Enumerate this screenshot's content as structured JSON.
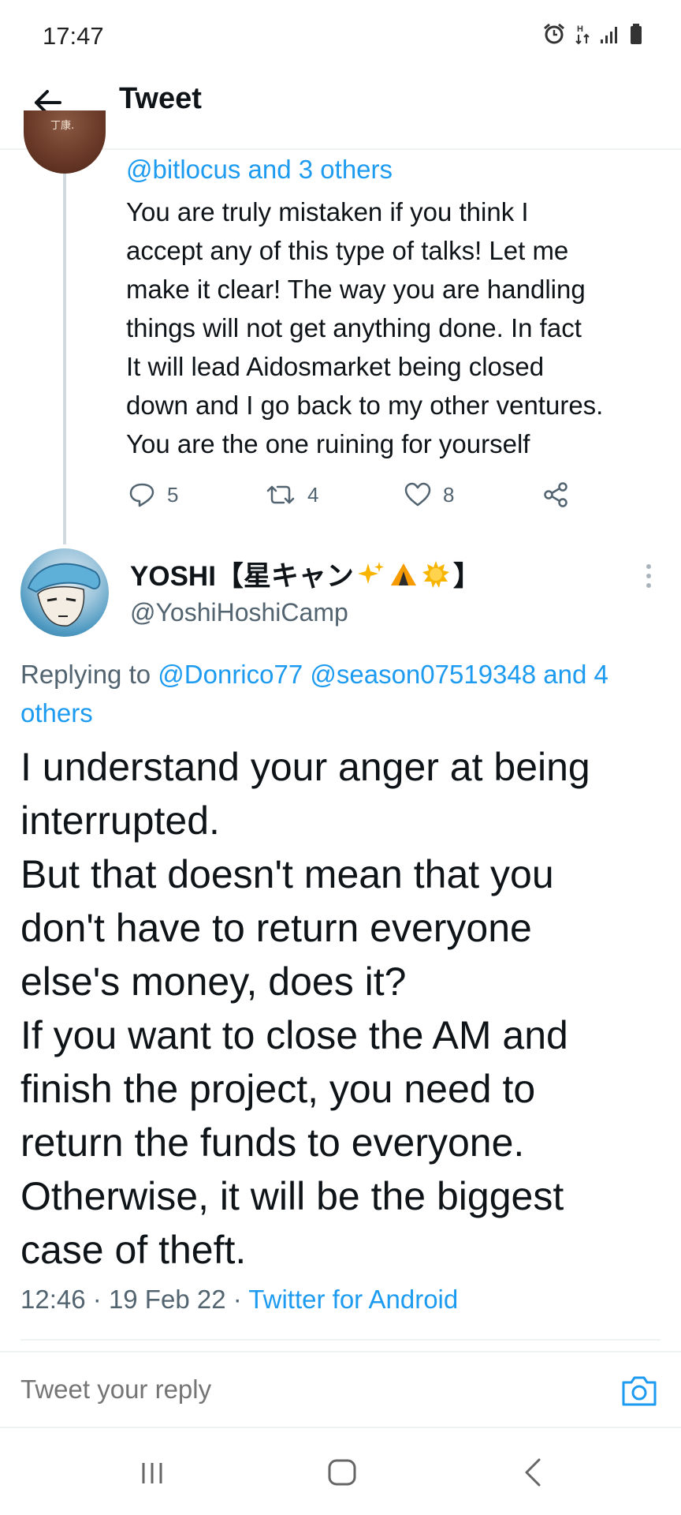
{
  "status_bar": {
    "time": "17:47"
  },
  "header": {
    "title": "Tweet"
  },
  "prev_tweet": {
    "avatar_text": "丁康.",
    "mentions": "@bitlocus and 3 others",
    "text": "You are truly mistaken if you think I\naccept any of this type of talks! Let me\nmake it clear! The way you are handling\nthings will not get anything done. In fact\nIt will lead Aidosmarket being closed\ndown and I go back to my other ventures.\nYou are the one ruining for yourself",
    "reply_count": "5",
    "retweet_count": "4",
    "like_count": "8"
  },
  "tweet": {
    "author_name": "YOSHI【星キャン",
    "author_name_end": "】",
    "handle": "@YoshiHoshiCamp",
    "replying_prefix": "Replying to",
    "replying_users": "@Donrico77 @season07519348 and 4 others",
    "text": "I understand your anger at being\ninterrupted.\nBut that doesn't mean that you\ndon't have to return everyone\nelse's money, does it?\nIf you want to close the AM and\nfinish the project, you need to\nreturn the funds to everyone.\nOtherwise, it will be the biggest\ncase of theft.",
    "time": "12:46",
    "date": "19 Feb 22",
    "source": "Twitter for Android"
  },
  "reply_box": {
    "placeholder": "Tweet your reply"
  },
  "colors": {
    "accent": "#1d9bf0",
    "secondary_text": "#536471",
    "primary_text": "#0f1419"
  },
  "icons": [
    "alarm-icon",
    "data-transfer-icon",
    "signal-icon",
    "battery-icon",
    "back-arrow-icon",
    "reply-icon",
    "retweet-icon",
    "like-icon",
    "share-icon",
    "more-icon",
    "sparkles-emoji",
    "tent-emoji",
    "sun-emoji",
    "camera-icon",
    "recents-icon",
    "home-icon",
    "nav-back-icon"
  ]
}
